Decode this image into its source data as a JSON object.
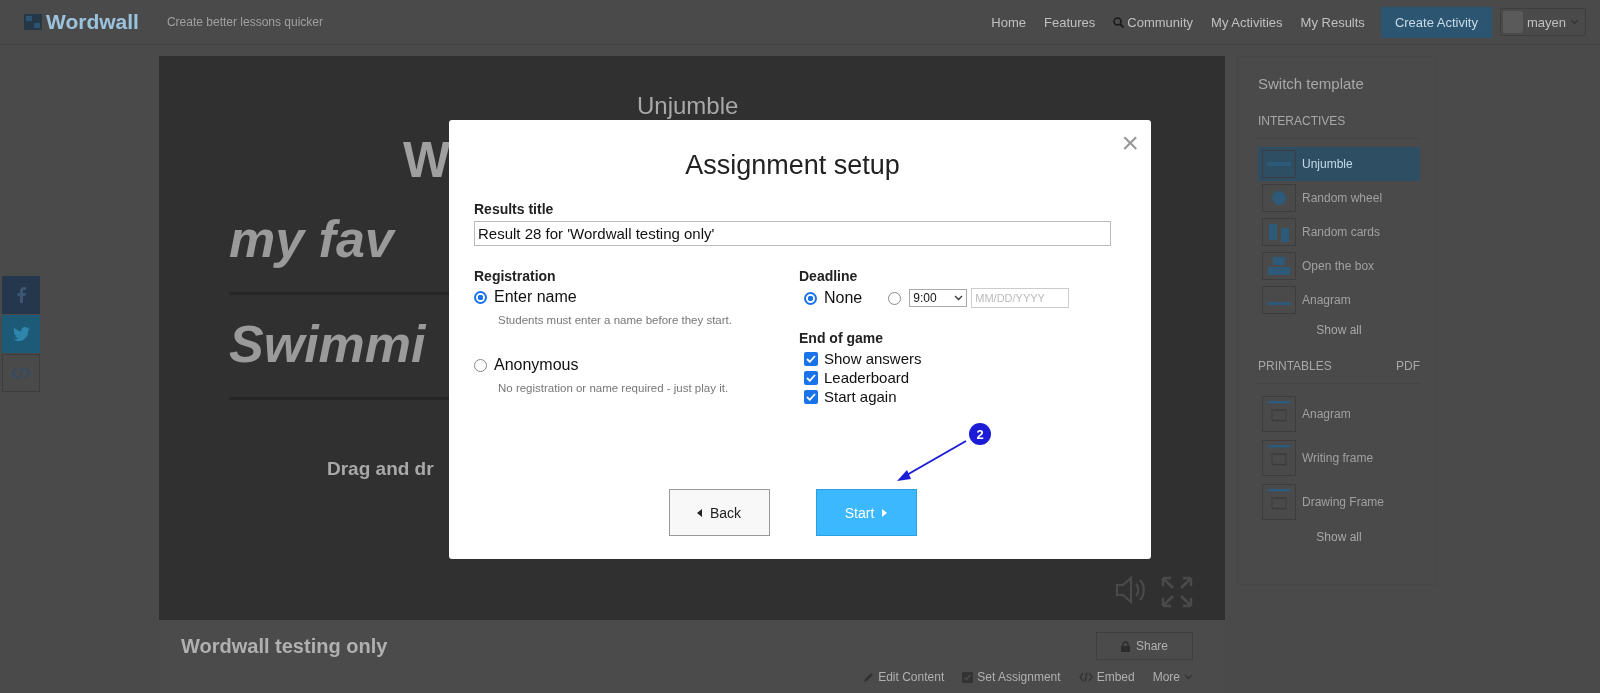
{
  "header": {
    "logo": "Wordwall",
    "tagline": "Create better lessons quicker",
    "nav": [
      {
        "label": "Home",
        "kind": "plain"
      },
      {
        "label": "Features",
        "kind": "plain"
      },
      {
        "label": "Community",
        "kind": "search"
      },
      {
        "label": "My Activities",
        "kind": "plain"
      },
      {
        "label": "My Results",
        "kind": "plain"
      }
    ],
    "create_button": "Create Activity",
    "user": "mayen"
  },
  "share_bar": [
    {
      "kind": "facebook"
    },
    {
      "kind": "twitter"
    },
    {
      "kind": "embed"
    }
  ],
  "game": {
    "title": "Unjumble",
    "lines": [
      {
        "kind": "heading",
        "text": "W"
      },
      {
        "kind": "word",
        "text": "my  fav"
      },
      {
        "kind": "word",
        "text": "Swimmi"
      }
    ],
    "instruction": "Drag and dr"
  },
  "activity": {
    "title": "Wordwall testing only",
    "share": "Share",
    "actions": [
      {
        "label": "Edit Content",
        "kind": "pencil"
      },
      {
        "label": "Set Assignment",
        "kind": "check"
      },
      {
        "label": "Embed",
        "kind": "code"
      },
      {
        "label": "More",
        "kind": "caret"
      }
    ]
  },
  "sidebar": {
    "title": "Switch template",
    "sections": [
      {
        "heading": "INTERACTIVES",
        "items": [
          {
            "label": "Unjumble",
            "selected": true,
            "kind": "unjumble"
          },
          {
            "label": "Random wheel",
            "selected": false,
            "kind": "wheel"
          },
          {
            "label": "Random cards",
            "selected": false,
            "kind": "cards"
          },
          {
            "label": "Open the box",
            "selected": false,
            "kind": "boxes"
          },
          {
            "label": "Anagram",
            "selected": false,
            "kind": "anagram"
          }
        ],
        "show_all": "Show all"
      },
      {
        "heading": "PRINTABLES",
        "extra": "PDF",
        "items": [
          {
            "label": "Anagram",
            "selected": false,
            "kind": "page"
          },
          {
            "label": "Writing frame",
            "selected": false,
            "kind": "page"
          },
          {
            "label": "Drawing Frame",
            "selected": false,
            "kind": "page"
          }
        ],
        "show_all": "Show all"
      }
    ]
  },
  "dialog": {
    "title": "Assignment setup",
    "close": "×",
    "results_label": "Results title",
    "results_value": "Result 28 for 'Wordwall testing only'",
    "registration": {
      "label": "Registration",
      "options": [
        {
          "label": "Enter name",
          "description": "Students must enter a name before they start.",
          "selected": true
        },
        {
          "label": "Anonymous",
          "description": "No registration or name required - just play it.",
          "selected": false
        }
      ]
    },
    "deadline": {
      "label": "Deadline",
      "options": [
        {
          "kind": "none",
          "label": "None",
          "selected": true
        },
        {
          "kind": "date",
          "time": "9:00",
          "date_placeholder": "MM/DD/YYYY",
          "selected": false
        }
      ]
    },
    "end_of_game": {
      "label": "End of game",
      "options": [
        {
          "label": "Show answers",
          "checked": true
        },
        {
          "label": "Leaderboard",
          "checked": true
        },
        {
          "label": "Start again",
          "checked": true
        }
      ]
    },
    "back": "Back",
    "start": "Start"
  },
  "annotation": {
    "label": "2"
  }
}
